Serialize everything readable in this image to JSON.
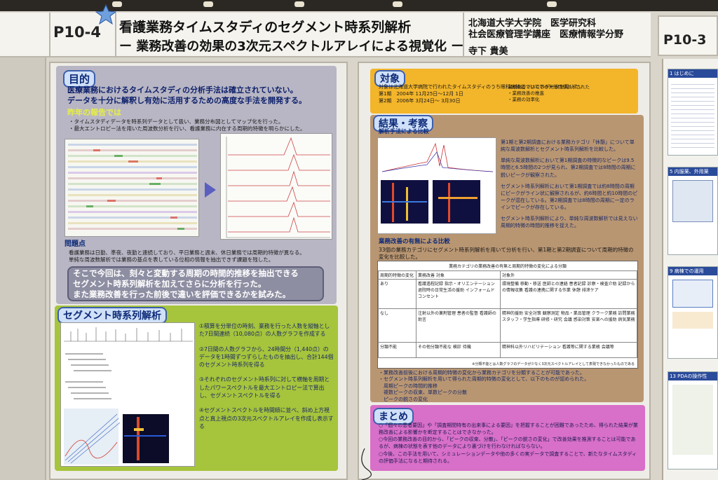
{
  "header": {
    "poster_code": "P10-4",
    "title_line1": "看護業務タイムスタディのセグメント時系列解析",
    "title_line2": "ー 業務改善の効果の3次元スペクトルアレイによる視覚化 ー",
    "affiliation_line1": "北海道大学大学院　医学研究科",
    "affiliation_line2": "社会医療管理学講座　医療情報学分野",
    "author": "寺下 貴美"
  },
  "next_poster": {
    "code": "P10-3",
    "sections": [
      "1 はじめに",
      "5 内服薬、外用薬",
      "9 病棟での運用",
      "13 PDAの操作性"
    ]
  },
  "left_panel": {
    "purpose": {
      "heading": "目的",
      "lines": [
        "医療業務におけるタイムスタディの分析手法は確立されていない。",
        "データを十分に解釈し有効に活用するための高度な手法を開発する。"
      ]
    },
    "last_year": {
      "heading": "昨年の報告では",
      "lines": [
        "・タイムスタディデータを時系列データとして扱い、業務分布図としてマップ化を行った。",
        "・最大エントロピー法を用いた周波数分析を行い、看護業務に内在する周期的特徴を明らかにした。"
      ]
    },
    "problem": {
      "heading": "問題点",
      "lines": [
        "看護業務は日勤、準夜、夜勤と連続しており、平日業務と週末、休日業務では周期的特徴が異なる。",
        "単純な周波数解析では業務の基点を表している位相の情報を抽出できず課題を残した。"
      ]
    },
    "callout": {
      "lines": [
        "そこで今回は、刻々と変動する周期の時間的推移を抽出できる",
        "セグメント時系列解析を加えてさらに分析を行った。",
        "また業務改善を行った前後で違いを評価できるかを試みた。"
      ]
    }
  },
  "segment_panel": {
    "heading": "セグメント時系列解析",
    "steps": [
      "①積算を分単位の時刻、業務を行った人数を縦軸とした7日間連続（10,080点）の人数グラフを作成する",
      "②7日間の人数グラフから、24時間分（1,440点）のデータを1時間ずつずらしたものを抽出し、合計144個のセグメント時系列を得る",
      "③それぞれのセグメント時系列に対して横軸を周期としたパワースペクトルを最大エントロピー法で算出し、セグメントスペクトルを得る",
      "④セグメントスペクトルを時間順に並べ、斜め上方視点と真上視点の3次元スペクトルアレイを作成し表示する"
    ]
  },
  "subject_panel": {
    "heading": "対象",
    "lines": [
      "対象は北海道大学病院で行われたタイムスタディのうち眼科病棟についてのデータを用いた。",
      "第1期　2004年 11月25日～12月 1日",
      "第2期　2006年 3月24日～ 3月30日"
    ],
    "side_lines": [
      "業務改善では以下の実施目標が示された",
      "・業務改善の推進",
      "・業務の効率化"
    ]
  },
  "results_panel": {
    "heading": "結果・考察",
    "subheading": "解析手法による比較",
    "bullets": [
      "第1期と第2期調査における業務カテゴリ「休憩」について単純な周波数解析とセグメント時系列解析を比較した。",
      "単純な周波数解析において第1期調査の特徴的なピークは9.5時間と6.5時間の2つが見られ、第2期調査では8時間の周期に鋭いピークが観察された。",
      "セグメント時系列解析において第1期調査では約8時間の周期にピークがライン状に観察されるが、約6時間と約10時間のピークが混在している。第2期調査では8時間の周期に一定のラインでピークが存在している。",
      "セグメント時系列解析により、単純な周波数解析では見えない周期的特徴の時間的推移を捉えた。"
    ],
    "improvement_heading": "業務改善の有無による比較",
    "improvement_lines": [
      "33個の業務カテゴリにセグメント時系列解析を用いて分析を行い、第1期と第2期調査について周期的特徴の変化を比較した。"
    ],
    "table_title": "業務カテゴリの業務改善の有無と周期的特徴の変化による分類",
    "table_headers": [
      "周期的特徴の変化",
      "業務改善 対象",
      "対象外"
    ],
    "table_rows": [
      {
        "change": "あり",
        "target": "看護過程記録 指示・オリエンテーション 退院時の日常生活の援助 インフォームドコンセント",
        "non_target": "環境整備 移動・移送 医師との連絡 患者記録 診察・検査介助 記録からの情報収集 看護の連携に関する作業 休憩 排泄ケア"
      },
      {
        "change": "なし",
        "target": "注射以外の薬剤管理 患者の監督 看護師の助言",
        "non_target": "精神的援助 安全対策 観察測定 物品・業品管理 クラーク業務 訪問業務 スタッフ・学生指導 研修・研究 会議 感染対策 安楽への援助 病気業務"
      },
      {
        "change": "分類不能",
        "target": "その他分類不能な 検診 待機",
        "non_target": "精神科以外リハビリテーション 看護等に関する業務 会議等"
      }
    ],
    "table_note": "※分類不能とは人数グラフのデータが少なく3次元スペクトルアレイとして表現できなかったものである",
    "after_lines": [
      "・業務改善前後における周期的特徴の変化から業務カテゴリを分類することが可能であった。",
      "・セグメント時系列解析を用いて得られた周期的特徴の変化として、以下のものが認められた。",
      "　周期ピークの時間的推移",
      "　複数ピークの収束、単数ピークの分散",
      "　ピークの鋭さの変化"
    ]
  },
  "summary_panel": {
    "heading": "まとめ",
    "lines": [
      "○「個々の患者要因」や「調査期間特有の出来事による要因」を把握することが困難であったため、得られた結果が業務改善による影響かを断定することはできなかった。",
      "○今回の業務改善の目的から、「ピークの収束、分散」、「ピークの鋭さの変化」で改善効果を推測することは可能であるが、病棟の状態を表す他のデータにより裏づけを行わなければならない。",
      "○今後、この手法を用いて、シミュレーションデータや他の多くの実データで調査することで、新たなタイムスタディの評価手法になると期待される。"
    ]
  },
  "colors": {
    "purpose_bg": "#b8b6c4",
    "segment_bg": "#a6c43c",
    "subject_bg": "#f3b52a",
    "results_bg": "#b99672",
    "summary_bg": "#d86fc8",
    "heading_blue": "#0d2a78"
  }
}
